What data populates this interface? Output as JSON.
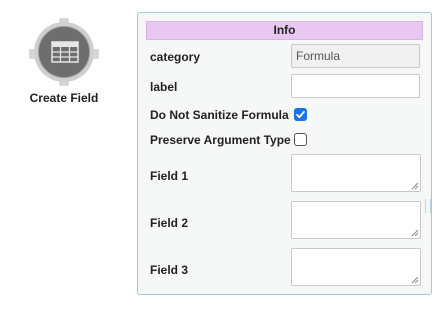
{
  "node": {
    "label": "Create Field",
    "icon": "table-icon"
  },
  "panel": {
    "title": "Info",
    "rows": {
      "category": {
        "label": "category",
        "value": "Formula"
      },
      "label": {
        "label": "label",
        "value": ""
      },
      "do_not_sanitize": {
        "label": "Do Not Sanitize Formula",
        "checked": true
      },
      "preserve_type": {
        "label": "Preserve Argument Type",
        "checked": false
      },
      "field1": {
        "label": "Field 1",
        "value": ""
      },
      "field2": {
        "label": "Field 2",
        "value": ""
      },
      "field3": {
        "label": "Field 3",
        "value": ""
      }
    }
  },
  "colors": {
    "header_bg": "#e8c8f2",
    "panel_border": "#9fc9d5",
    "checkbox_checked": "#1a73e8",
    "node_fill": "#6e6e6e"
  }
}
